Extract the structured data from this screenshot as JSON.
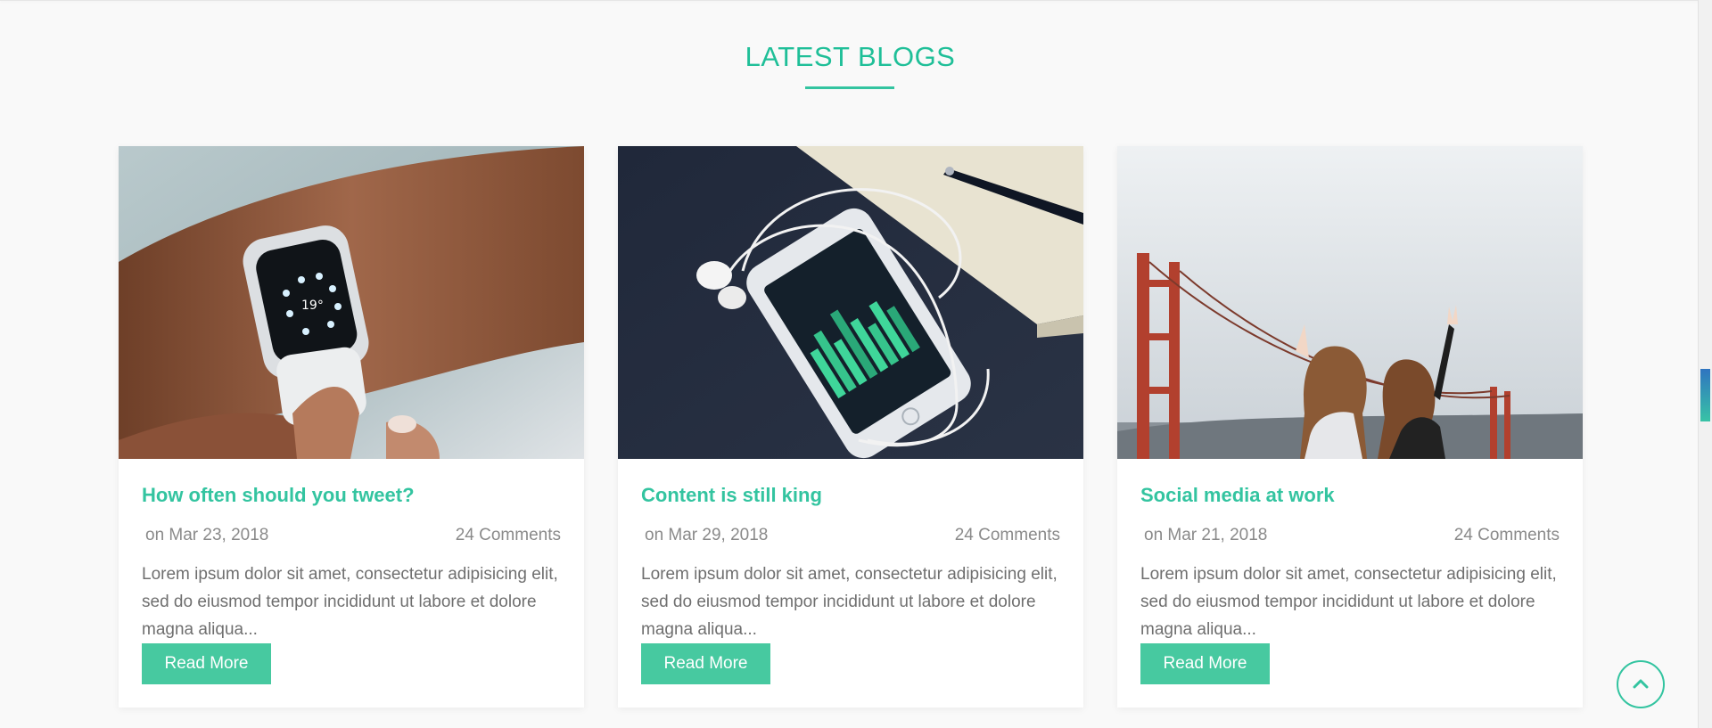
{
  "section": {
    "title": "LATEST BLOGS"
  },
  "colors": {
    "accent": "#33c4a0",
    "button": "#47c9a0",
    "text": "#6f6f6f",
    "meta": "#8a8a8a"
  },
  "posts": [
    {
      "image": "smartwatch-photo",
      "title": "How often should you tweet?",
      "date": "on Mar 23, 2018",
      "comments": "24 Comments",
      "excerpt": "Lorem ipsum dolor sit amet, consectetur adipisicing elit, sed do eiusmod tempor incididunt ut labore et dolore magna aliqua...",
      "button": "Read More"
    },
    {
      "image": "phone-earphones-photo",
      "title": "Content is still king",
      "date": "on Mar 29, 2018",
      "comments": "24 Comments",
      "excerpt": "Lorem ipsum dolor sit amet, consectetur adipisicing elit, sed do eiusmod tempor incididunt ut labore et dolore magna aliqua...",
      "button": "Read More"
    },
    {
      "image": "golden-gate-friends-photo",
      "title": "Social media at work",
      "date": "on Mar 21, 2018",
      "comments": "24 Comments",
      "excerpt": "Lorem ipsum dolor sit amet, consectetur adipisicing elit, sed do eiusmod tempor incididunt ut labore et dolore magna aliqua...",
      "button": "Read More"
    }
  ],
  "scroll_top": {
    "icon": "chevron-up-icon"
  }
}
